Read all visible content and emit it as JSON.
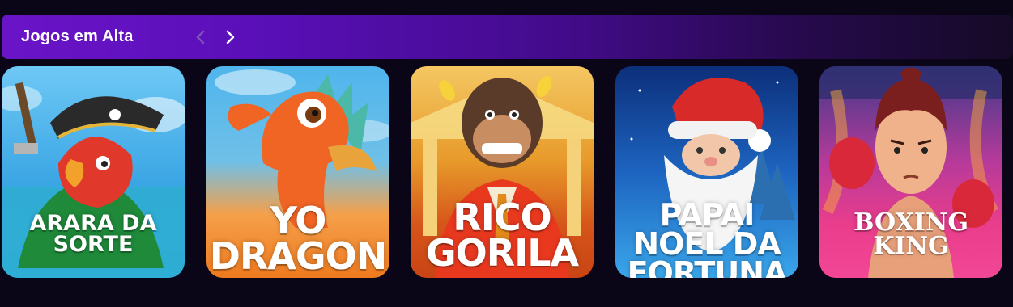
{
  "header": {
    "title": "Jogos em Alta",
    "prev_icon": "chevron-left-icon",
    "next_icon": "chevron-right-icon"
  },
  "games": [
    {
      "line1": "ARARA DA",
      "line2": "SORTE"
    },
    {
      "line1": "YO",
      "line2": "DRAGON"
    },
    {
      "line1": "RICO",
      "line2": "GORILA"
    },
    {
      "line1": "PAPAI",
      "line2": "NOEL DA",
      "line3": "FORTUNA"
    },
    {
      "line1": "BOXING",
      "line2": "KING"
    }
  ],
  "colors": {
    "background": "#0b0617",
    "header_start": "#6a14c8",
    "header_end": "#150a26"
  }
}
